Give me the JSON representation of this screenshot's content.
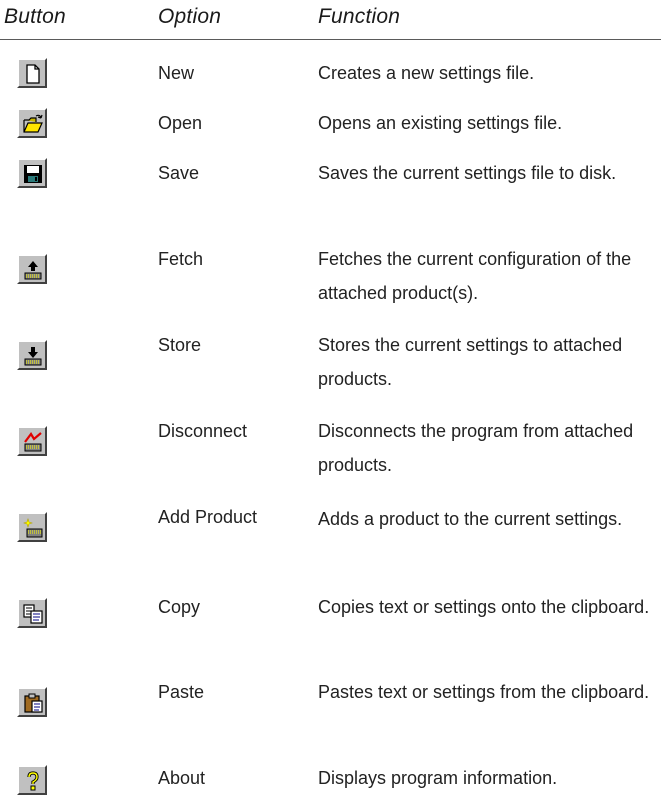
{
  "header": {
    "button": "Button",
    "option": "Option",
    "function": "Function"
  },
  "rows": [
    {
      "icon": "new-file-icon",
      "option": "New",
      "function": "Creates a new settings file."
    },
    {
      "icon": "open-folder-icon",
      "option": "Open",
      "function": "Opens an existing settings file."
    },
    {
      "icon": "save-disk-icon",
      "option": "Save",
      "function": "Saves the current settings file to disk."
    },
    {
      "icon": "fetch-icon",
      "option": "Fetch",
      "function": "Fetches the current configuration of the attached product(s)."
    },
    {
      "icon": "store-icon",
      "option": "Store",
      "function": "Stores the current settings to attached products."
    },
    {
      "icon": "disconnect-icon",
      "option": "Disconnect",
      "function": "Disconnects the program from attached products."
    },
    {
      "icon": "add-product-icon",
      "option": "Add Product",
      "function": "Adds a product to the current settings."
    },
    {
      "icon": "copy-icon",
      "option": "Copy",
      "function": "Copies text or settings onto the clipboard."
    },
    {
      "icon": "paste-icon",
      "option": "Paste",
      "function": "Pastes text or settings from the clipboard."
    },
    {
      "icon": "about-help-icon",
      "option": "About",
      "function": "Displays program information."
    }
  ]
}
